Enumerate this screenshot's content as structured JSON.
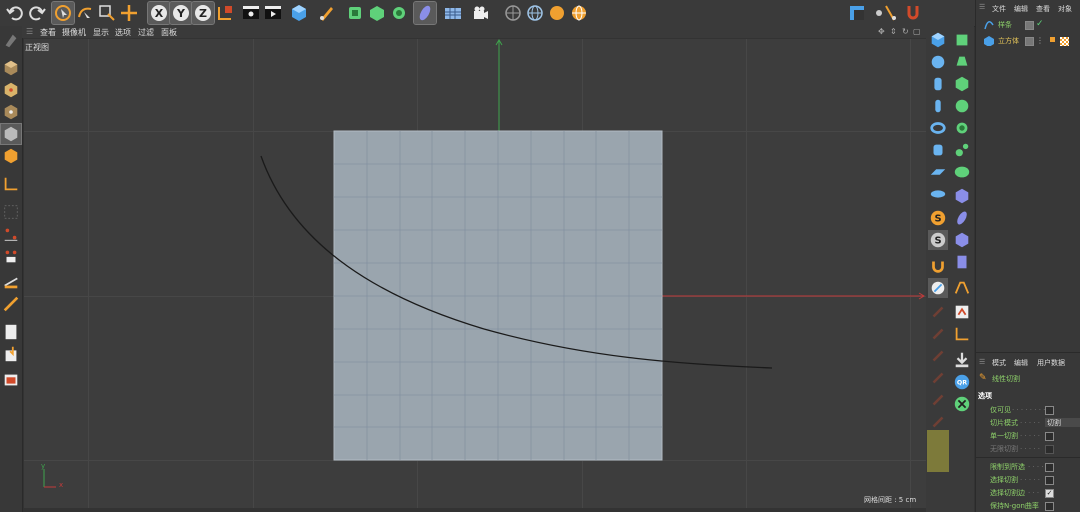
{
  "viewport_menu": {
    "items": [
      "查看",
      "摄像机",
      "显示",
      "选项",
      "过滤",
      "面板"
    ],
    "view_name": "正视图",
    "grid_spacing": "网格间距 : 5 cm"
  },
  "axis": {
    "y": "y",
    "x": "x"
  },
  "object_manager": {
    "menu": [
      "文件",
      "编辑",
      "查看",
      "对象"
    ],
    "objects": [
      {
        "name": "样条",
        "color": "#7fd35a"
      },
      {
        "name": "立方体",
        "color": "#e8c75a"
      }
    ]
  },
  "attributes": {
    "menu": [
      "模式",
      "编辑",
      "用户数据"
    ],
    "tool_name": "线性切割",
    "section": "选项",
    "options": [
      {
        "label": "仅可见",
        "type": "checkbox",
        "checked": false,
        "enabled": true
      },
      {
        "label": "切片模式",
        "type": "select",
        "value": "切割",
        "enabled": true
      },
      {
        "label": "单一切割",
        "type": "checkbox",
        "checked": false,
        "enabled": true
      },
      {
        "label": "无限切割",
        "type": "checkbox",
        "checked": false,
        "enabled": false
      },
      {
        "label": "限制到所选",
        "type": "checkbox",
        "checked": false,
        "enabled": true
      },
      {
        "label": "选择切割",
        "type": "checkbox",
        "checked": false,
        "enabled": true
      },
      {
        "label": "选择切割边",
        "type": "checkbox",
        "checked": true,
        "enabled": true
      },
      {
        "label": "保持N-gon曲率",
        "type": "checkbox",
        "checked": false,
        "enabled": true
      }
    ]
  },
  "colors": {
    "accent": "#f0a030",
    "green_axis": "#3fa34d",
    "red_axis": "#c23b3b",
    "plane": "#9aa5ae",
    "label_green": "#8ed16a"
  }
}
